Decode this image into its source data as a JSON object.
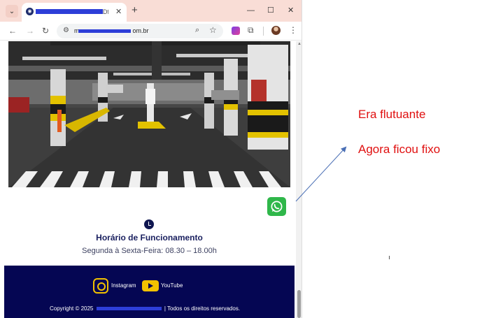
{
  "browser": {
    "tab_title": "Dfut",
    "url_suffix": "m",
    "url_end": "om.br",
    "window_controls": {
      "minimize": "—",
      "maximize": "☐",
      "close": "✕"
    },
    "icons": {
      "tab_menu": "chevron-down-icon",
      "back": "arrow-left-icon",
      "forward": "arrow-right-icon",
      "reload": "reload-icon",
      "site_settings": "tune-icon",
      "zoom": "zoom-icon",
      "bookmark": "star-icon",
      "extension": "puzzle-icon",
      "menu": "kebab-icon"
    }
  },
  "page": {
    "hours": {
      "title": "Horário de Funcionamento",
      "text": "Segunda à Sexta-Feira: 08.30 – 18.00h"
    },
    "footer": {
      "instagram_label": "Instagram",
      "youtube_label": "YouTube",
      "copyright_prefix": "Copyright © 2025",
      "copyright_suffix": "| Todos os direitos reservados."
    },
    "colors": {
      "footer_bg": "#050653",
      "accent_yellow": "#f2c200",
      "whatsapp": "#2fb74a",
      "heading": "#1b2160"
    }
  },
  "annotations": {
    "line1": "Era flutuante",
    "line2": "Agora ficou fixo",
    "color": "#e01010"
  }
}
